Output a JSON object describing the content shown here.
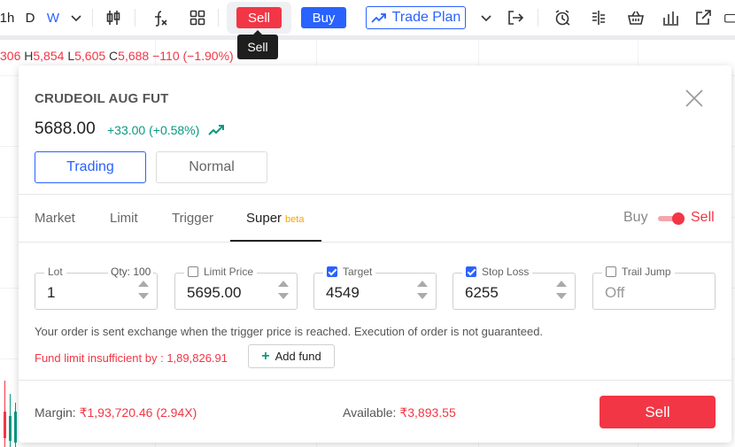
{
  "toolbar": {
    "interval_1h": "1h",
    "interval_d": "D",
    "interval_w": "W",
    "sell_label": "Sell",
    "buy_label": "Buy",
    "trade_plan_label": "Trade Plan",
    "tooltip": "Sell"
  },
  "ohlc": {
    "o_value": "306",
    "h_key": "H",
    "h_value": "5,854",
    "l_key": "L",
    "l_value": "5,605",
    "c_key": "C",
    "c_value": "5,688",
    "change": "−110 (−1.90%)"
  },
  "order": {
    "instrument": "CRUDEOIL AUG FUT",
    "price": "5688.00",
    "change": "+33.00 (+0.58%)",
    "modes": {
      "trading": "Trading",
      "normal": "Normal"
    },
    "tabs": {
      "market": "Market",
      "limit": "Limit",
      "trigger": "Trigger",
      "super": "Super",
      "super_badge": "beta"
    },
    "side": {
      "buy": "Buy",
      "sell": "Sell",
      "selected": "Sell"
    },
    "fields": {
      "lot_label": "Lot",
      "lot_value": "1",
      "qty_label": "Qty: 100",
      "limit_price_label": "Limit Price",
      "limit_price_value": "5695.00",
      "target_label": "Target",
      "target_value": "4549",
      "stop_loss_label": "Stop Loss",
      "stop_loss_value": "6255",
      "trail_jump_label": "Trail Jump",
      "trail_jump_value": "Off"
    },
    "checkboxes": {
      "limit_price": false,
      "target": true,
      "stop_loss": true,
      "trail_jump": false
    },
    "note": "Your order is sent exchange when the trigger price is reached. Execution of order is not guaranteed.",
    "fund_warning": "Fund limit insufficient by : 1,89,826.91",
    "add_fund_label": "Add fund",
    "margin_label": "Margin:",
    "margin_value": "₹1,93,720.46 (2.94X)",
    "available_label": "Available:",
    "available_value": "₹3,893.55",
    "submit_label": "Sell"
  },
  "colors": {
    "sell": "#f23645",
    "buy": "#2962ff",
    "up": "#089981",
    "beta": "#f7a600"
  }
}
